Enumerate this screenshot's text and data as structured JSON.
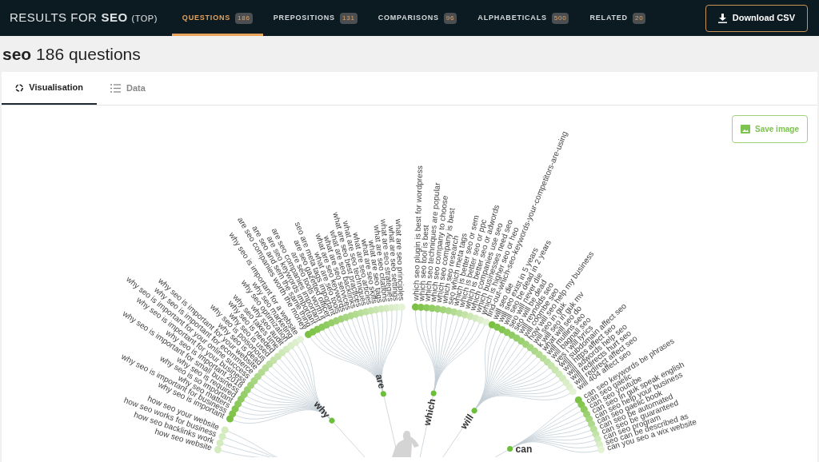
{
  "header": {
    "prefix": "RESULTS FOR",
    "keyword": "SEO",
    "scope": "(TOP)"
  },
  "nav": [
    {
      "label": "QUESTIONS",
      "count": "186",
      "selected": true
    },
    {
      "label": "PREPOSITIONS",
      "count": "131",
      "selected": false
    },
    {
      "label": "COMPARISONS",
      "count": "96",
      "selected": false
    },
    {
      "label": "ALPHABETICALS",
      "count": "500",
      "selected": false
    },
    {
      "label": "RELATED",
      "count": "20",
      "selected": false
    }
  ],
  "download_button": "Download CSV",
  "title": "**seo** 186 questions",
  "view_tabs": [
    {
      "label": "Visualisation",
      "kind": "wheel",
      "selected": true
    },
    {
      "label": "Data",
      "kind": "list",
      "selected": false
    }
  ],
  "save_button": "Save image",
  "groups": [
    {
      "questions": [
        "how seo your website",
        "how seo works for business",
        "how seo backlinks work",
        "how seo website"
      ]
    },
    {
      "label": "why",
      "questions": [
        "why seo is important",
        "why seo is important for business",
        "why seo matters",
        "why seo is so important",
        "why seo is required",
        "why seo is important for small business",
        "why seo is important 2018",
        "why seo is important for your business",
        "why seo is important for your online success",
        "why seo is important for ecommerce",
        "why seo is important for your website",
        "why seo is dead",
        "why seo is poisonous",
        "why seo is used",
        "why seo is needed",
        "why seo takes time",
        "why seo audit",
        "why seo optimization",
        "why seo marketing",
        "why seo is important for a website"
      ]
    },
    {
      "label": "are",
      "questions": [
        "are seo companies worth the money",
        "are seo and sem the same thing",
        "are seo keywords important",
        "are seo companies important",
        "are seo tools worth it",
        "are seo gazetted officer",
        "seo are meta tags important",
        "what are seo tools",
        "what are seo keywords",
        "what are seo services",
        "what are seo backlinks",
        "what are seo best practices",
        "what are seo techniques",
        "what are seo articles",
        "what are seo skills",
        "what are seo tags",
        "what are seo citations",
        "what are seo strategies",
        "what are seo settings",
        "what are seo principles"
      ]
    },
    {
      "label": "which",
      "questions": [
        "which seo plugin is best for wordpress",
        "which seo tool is best",
        "which seo techniques are popular",
        "which seo company to choose",
        "which seo company is best",
        "which seo research",
        "seo which meta tags",
        "which is better seo or sem",
        "which is better seo or ppc",
        "which is better seo or adwords",
        "which companies use seo",
        "which businesses need seo",
        "which is higher seo or heo",
        "find-out-which-seo-keywords-your-competitors-are-using"
      ]
    },
    {
      "label": "will",
      "questions": [
        "will seo die",
        "will seo exist in 5 years",
        "will seo be dead in 2 years",
        "seo will never die",
        "seo will be dead",
        "will reynolds seo",
        "will coombe seo",
        "how will seo help my business",
        "will seo in guk",
        "k will seo in guk mv",
        "what will seo do",
        "will mullins seo",
        "will bagnall seo",
        "yes i will lyrics",
        "will subdomain affect seo",
        "will https affect seo",
        "will adwords help seo",
        "will redirects hurt seo",
        "will redirect affect seo",
        "will 404 affect seo"
      ]
    },
    {
      "label": "can",
      "questions": [
        "can seo keywords be phrases",
        "can seo gaelic",
        "can seo youtube",
        "can seo in guk speak english",
        "can seo help your business",
        "can seo gaelic book",
        "can seo be automated",
        "can seo be guaranteed",
        "can seo program",
        "seo can be described as",
        "can you seo a wix website"
      ]
    }
  ]
}
